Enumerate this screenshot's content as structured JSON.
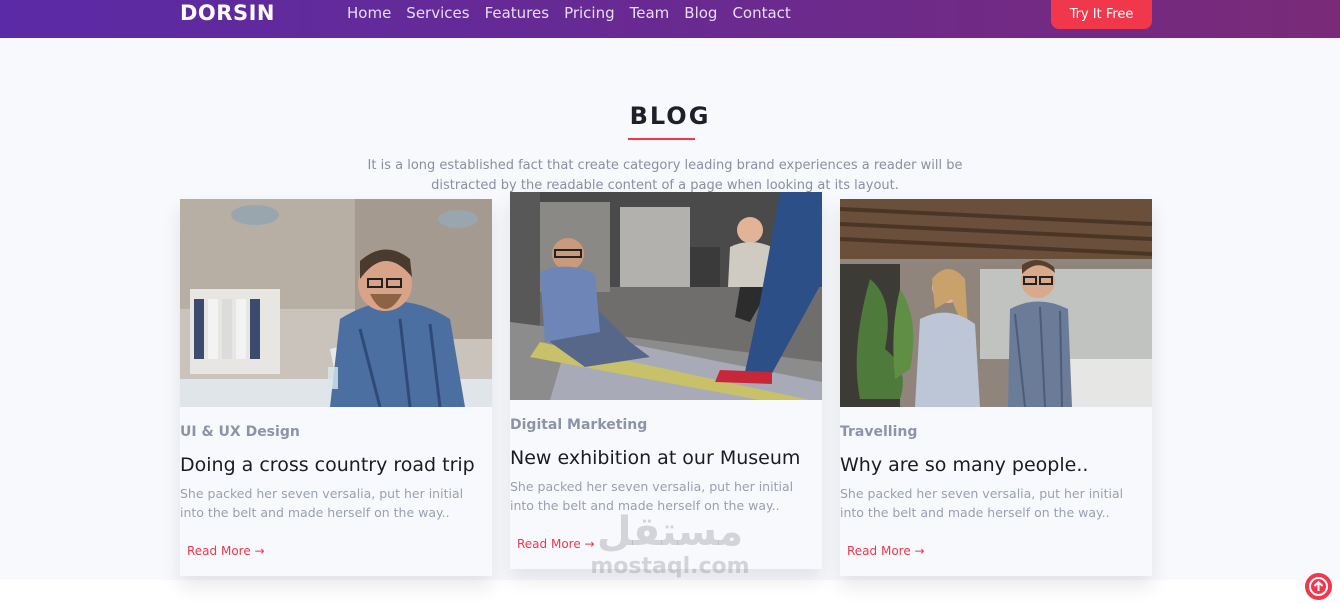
{
  "brand": {
    "name": "DORSIN"
  },
  "nav": {
    "links": [
      "Home",
      "Services",
      "Features",
      "Pricing",
      "Team",
      "Blog",
      "Contact"
    ],
    "cta": "Try It Free"
  },
  "section": {
    "title": "BLOG",
    "subtitle": "It is a long established fact that create category leading brand experiences a reader will be distracted by the readable content of a page when looking at its layout."
  },
  "posts": [
    {
      "category": "UI & UX Design",
      "title": "Doing a cross country road trip",
      "excerpt": "She packed her seven versalia, put her initial into the belt and made herself on the way..",
      "link": "Read More",
      "image": "man-at-laptop-photo"
    },
    {
      "category": "Digital Marketing",
      "title": "New exhibition at our Museum",
      "excerpt": "She packed her seven versalia, put her initial into the belt and made herself on the way..",
      "link": "Read More",
      "image": "office-floor-meeting-photo"
    },
    {
      "category": "Travelling",
      "title": "Why are so many people..",
      "excerpt": "She packed her seven versalia, put her initial into the belt and made herself on the way..",
      "link": "Read More",
      "image": "office-colleagues-talking-photo"
    }
  ],
  "watermark": {
    "arabic": "مستقل",
    "latin": "mostaql.com"
  },
  "colors": {
    "accent": "#f0374c",
    "nav_start": "#5b2aa6",
    "nav_end": "#7a2a78"
  },
  "icons": {
    "arrow": "arrow-right-icon",
    "scroll_top": "arrow-up-circle-icon"
  }
}
